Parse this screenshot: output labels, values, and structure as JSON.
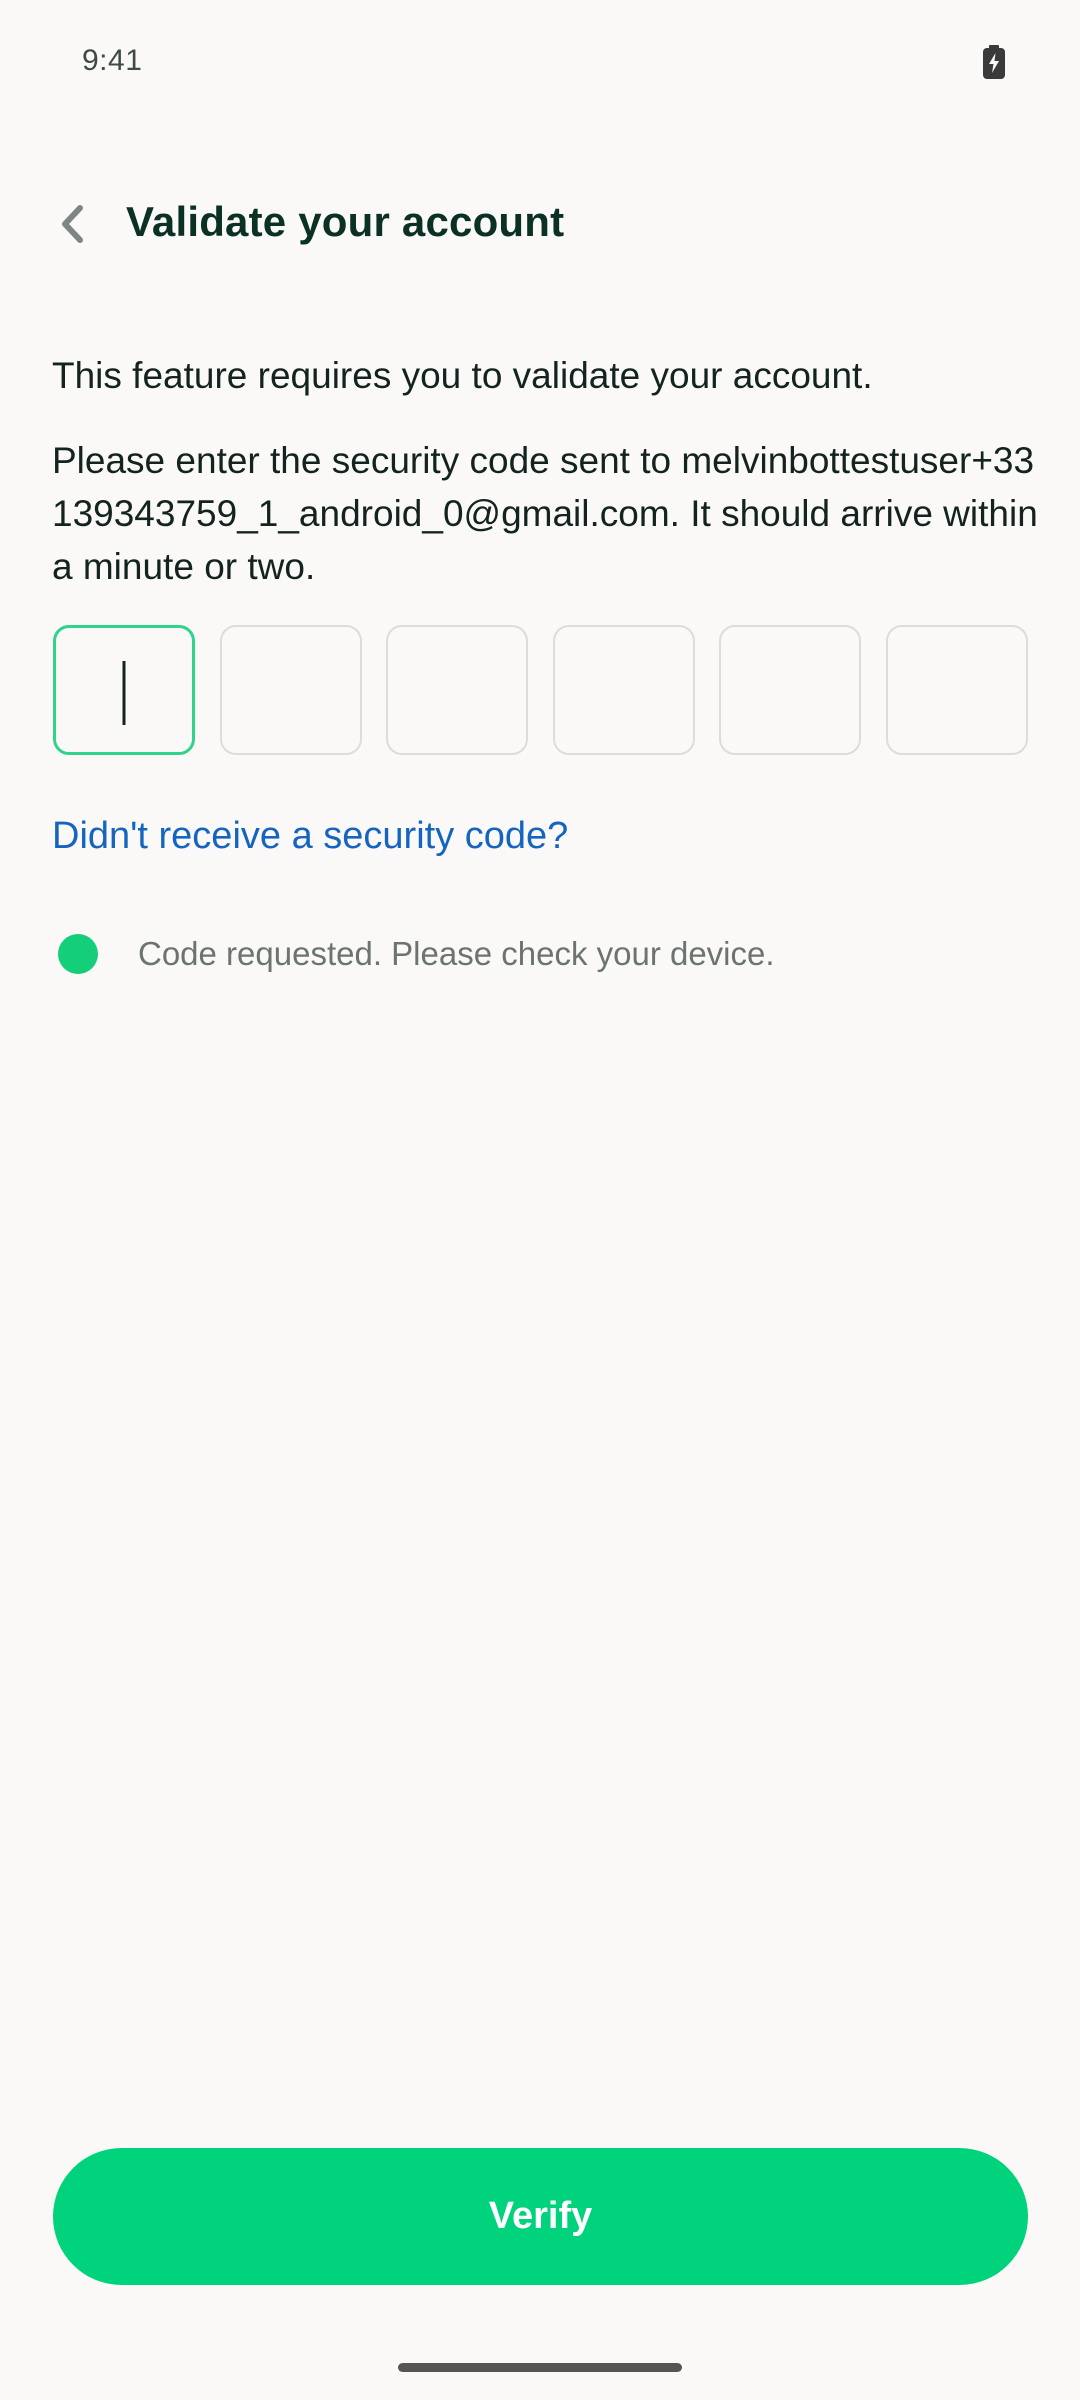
{
  "status_bar": {
    "time": "9:41",
    "battery_icon": "battery-charging-icon"
  },
  "header": {
    "back_icon": "chevron-left-icon",
    "title": "Validate your account"
  },
  "content": {
    "intro": "This feature requires you to validate your account.",
    "instruction": "Please enter the security code sent to melvinbottestuser+33139343759_1_android_0@gmail.com. It should arrive within a minute or two.",
    "code_inputs": [
      {
        "value": ""
      },
      {
        "value": ""
      },
      {
        "value": ""
      },
      {
        "value": ""
      },
      {
        "value": ""
      },
      {
        "value": ""
      }
    ],
    "resend_link": "Didn't receive a security code?",
    "status_message": "Code requested. Please check your device."
  },
  "footer": {
    "verify_label": "Verify"
  },
  "colors": {
    "accent": "#01D37C",
    "link": "#1565C0",
    "background": "#FBF9F8"
  }
}
